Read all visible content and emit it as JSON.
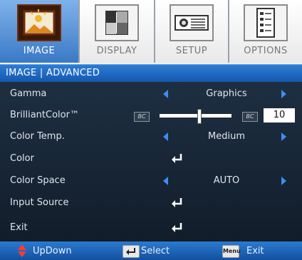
{
  "tabs": [
    {
      "label": "IMAGE",
      "icon": "image-icon",
      "active": true
    },
    {
      "label": "DISPLAY",
      "icon": "display-icon",
      "active": false
    },
    {
      "label": "SETUP",
      "icon": "projector-icon",
      "active": false
    },
    {
      "label": "OPTIONS",
      "icon": "options-icon",
      "active": false
    }
  ],
  "title": "IMAGE | ADVANCED",
  "menu": {
    "gamma": {
      "label": "Gamma",
      "value": "Graphics"
    },
    "brilliant_color": {
      "label": "BrilliantColor™",
      "min_icon": "BC",
      "max_icon": "BC",
      "value": "10",
      "level_fraction": 0.55
    },
    "color_temp": {
      "label": "Color Temp.",
      "value": "Medium"
    },
    "color": {
      "label": "Color"
    },
    "color_space": {
      "label": "Color Space",
      "value": "AUTO"
    },
    "input_source": {
      "label": "Input Source"
    },
    "exit": {
      "label": "Exit"
    }
  },
  "hints": {
    "updown": "UpDown",
    "select": "Select",
    "menu_key": "Menu",
    "exit": "Exit"
  },
  "colors": {
    "accent": "#1f6cc7",
    "arrow": "#3d8df4",
    "menu_bg": "#1a2838"
  }
}
